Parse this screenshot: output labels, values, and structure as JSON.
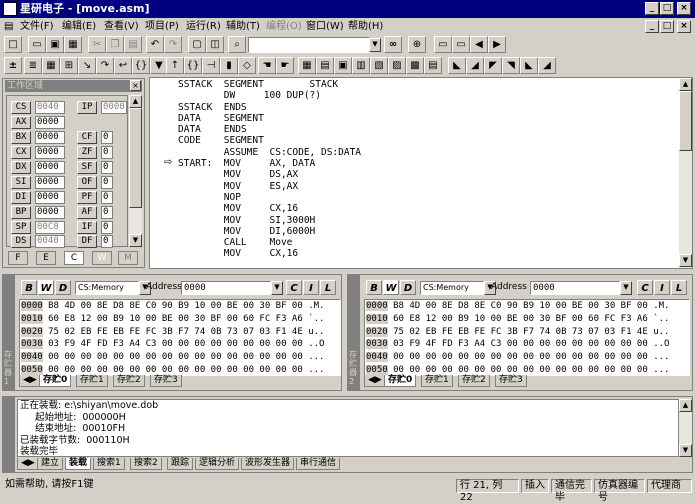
{
  "title": "星研电子 - [move.asm]",
  "menu": [
    "文件(F)",
    "编辑(E)",
    "查看(V)",
    "项目(P)",
    "运行(R)",
    "辅助(T)",
    "编程(O)",
    "窗口(W)",
    "帮助(H)"
  ],
  "regs_panel_title": "工作区域",
  "regs": {
    "cs": "0040",
    "ip": "0000",
    "ax": "0000",
    "bx": "0000",
    "cx": "0000",
    "dx": "0000",
    "si": "0000",
    "di": "0000",
    "bp": "0000",
    "sp": "00C8",
    "ds": "0040",
    "cf": "0",
    "zf": "0",
    "sf": "0",
    "of": "0",
    "pf": "0",
    "af": "0",
    "if": "0",
    "df": "0"
  },
  "reg_names": {
    "cs": "CS",
    "ip": "IP",
    "ax": "AX",
    "bx": "BX",
    "cx": "CX",
    "dx": "DX",
    "si": "SI",
    "di": "DI",
    "bp": "BP",
    "sp": "SP",
    "ds": "DS",
    "cf": "CF",
    "zf": "ZF",
    "sf": "SF",
    "of": "OF",
    "pf": "PF",
    "af": "AF",
    "if": "IF",
    "df": "DF"
  },
  "ws_tabs": [
    "F",
    "E",
    "C",
    "W",
    "M"
  ],
  "code_lines": [
    "SSTACK  SEGMENT        STACK",
    "        DW     100 DUP(?)",
    "SSTACK  ENDS",
    "DATA    SEGMENT",
    "DATA    ENDS",
    "CODE    SEGMENT",
    "        ASSUME  CS:CODE, DS:DATA",
    "START:  MOV     AX, DATA",
    "        MOV     DS,AX",
    "        MOV     ES,AX",
    "        NOP",
    "        MOV     CX,16",
    "        MOV     SI,3000H",
    "        MOV     DI,6000H",
    "        CALL    Move",
    "        MOV     CX,16"
  ],
  "mem_combo": "CS:Memory",
  "address_label": "Address",
  "address_value": "0000",
  "mem_left": [
    "0000 B8 4D 00 8E D8 8E C0 90 B9 10 00 BE 00 30 BF 00 .M.",
    "0010 60 E8 12 00 B9 10 00 BE 00 30 BF 00 60 FC F3 A6 `..",
    "0020 75 02 EB FE EB FE FC 3B F7 74 0B 73 07 03 F1 4E u..",
    "0030 03 F9 4F FD F3 A4 C3 00 00 00 00 00 00 00 00 00 ..O",
    "0040 00 00 00 00 00 00 00 00 00 00 00 00 00 00 00 00 ...",
    "0050 00 00 00 00 00 00 00 00 00 00 00 00 00 00 00 00 ..."
  ],
  "mem_right": [
    "0000 B8 4D 00 8E D8 8E C0 90 B9 10 00 BE 00 30 BF 00 .M.",
    "0010 60 E8 12 00 B9 10 00 BE 00 30 BF 00 60 FC F3 A6 `..",
    "0020 75 02 EB FE EB FE FC 3B F7 74 0B 73 07 03 F1 4E u..",
    "0030 03 F9 4F FD F3 A4 C3 00 00 00 00 00 00 00 00 00 ..O",
    "0040 00 00 00 00 00 00 00 00 00 00 00 00 00 00 00 00 ...",
    "0050 00 00 00 00 00 00 00 00 00 00 00 00 00 00 00 00 ..."
  ],
  "mem_tabs": [
    "存贮0",
    "存贮1",
    "存贮2",
    "存贮3"
  ],
  "mem_left_vlabel": "存贮器1",
  "mem_right_vlabel": "存贮器2",
  "output_lines": [
    "正在装载: e:\\shiyan\\move.dob",
    "     起始地址:  000000H",
    "     结束地址:  00010FH",
    "已装载字节数:  000110H",
    "装载完毕"
  ],
  "output_tabs": [
    "建立",
    "装载",
    "搜索1",
    "搜索2",
    "跟踪",
    "逻辑分析",
    "波形发生器",
    "串行通信"
  ],
  "status": {
    "help": "如需帮助, 请按F1键",
    "pos": "行 21, 列 22",
    "ins": "插入",
    "comm": "通信完毕",
    "emu": "仿真器编号",
    "proxy": "代理商"
  }
}
